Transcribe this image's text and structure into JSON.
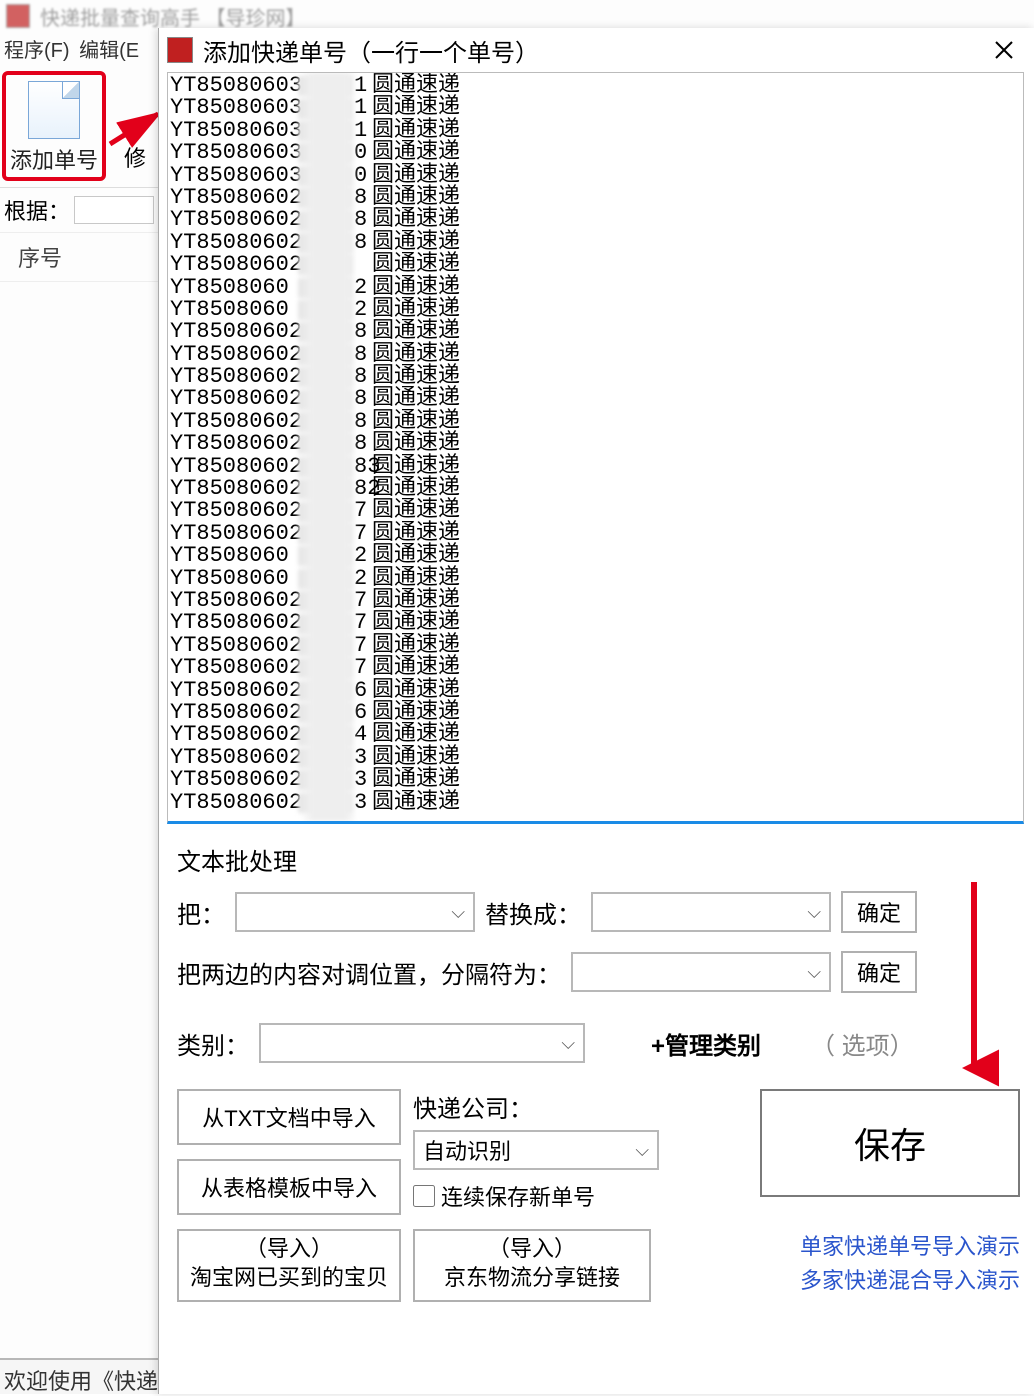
{
  "main": {
    "title": "快递批量查询高手 【导珍网】",
    "menu": {
      "program": "程序(F)",
      "edit": "编辑(E"
    },
    "toolbar": {
      "add_tracking": "添加单号",
      "modify": "修"
    },
    "filter_label": "根据：",
    "table": {
      "col_seq": "序号"
    },
    "status": "欢迎使用《快递"
  },
  "dialog": {
    "title": "添加快递单号（一行一个单号）",
    "tracking_rows": [
      {
        "p": "YT85080603",
        "s": "1",
        "c": "圆通速递"
      },
      {
        "p": "YT85080603",
        "s": "1",
        "c": "圆通速递"
      },
      {
        "p": "YT85080603",
        "s": "1",
        "c": "圆通速递"
      },
      {
        "p": "YT85080603",
        "s": "0",
        "c": "圆通速递"
      },
      {
        "p": "YT85080603",
        "s": "0",
        "c": "圆通速递"
      },
      {
        "p": "YT85080602",
        "s": "8",
        "c": "圆通速递"
      },
      {
        "p": "YT85080602",
        "s": "8",
        "c": "圆通速递"
      },
      {
        "p": "YT85080602",
        "s": "8",
        "c": "圆通速递"
      },
      {
        "p": "YT85080602",
        "s": "",
        "c": "圆通速递"
      },
      {
        "p": "YT8508060",
        "s": "2",
        "c": "圆通速递"
      },
      {
        "p": "YT8508060",
        "s": "2",
        "c": "圆通速递"
      },
      {
        "p": "YT85080602",
        "s": "8",
        "c": "圆通速递"
      },
      {
        "p": "YT85080602",
        "s": "8",
        "c": "圆通速递"
      },
      {
        "p": "YT85080602",
        "s": "8",
        "c": "圆通速递"
      },
      {
        "p": "YT85080602",
        "s": "8",
        "c": "圆通速递"
      },
      {
        "p": "YT85080602",
        "s": "8",
        "c": "圆通速递"
      },
      {
        "p": "YT85080602",
        "s": "8",
        "c": "圆通速递"
      },
      {
        "p": "YT85080602",
        "s": "83",
        "c": "圆通速递"
      },
      {
        "p": "YT85080602",
        "s": "82",
        "c": "圆通速递"
      },
      {
        "p": "YT85080602",
        "s": "7",
        "c": "圆通速递"
      },
      {
        "p": "YT85080602",
        "s": "7",
        "c": "圆通速递"
      },
      {
        "p": "YT8508060",
        "s": "2",
        "c": "圆通速递"
      },
      {
        "p": "YT8508060",
        "s": "2",
        "c": "圆通速递"
      },
      {
        "p": "YT85080602",
        "s": "7",
        "c": "圆通速递"
      },
      {
        "p": "YT85080602",
        "s": "7",
        "c": "圆通速递"
      },
      {
        "p": "YT85080602",
        "s": "7",
        "c": "圆通速递"
      },
      {
        "p": "YT85080602",
        "s": "7",
        "c": "圆通速递"
      },
      {
        "p": "YT85080602",
        "s": "6",
        "c": "圆通速递"
      },
      {
        "p": "YT85080602",
        "s": "6",
        "c": "圆通速递"
      },
      {
        "p": "YT85080602",
        "s": "4",
        "c": "圆通速递"
      },
      {
        "p": "YT85080602",
        "s": "3",
        "c": "圆通速递"
      },
      {
        "p": "YT85080602",
        "s": "3",
        "c": "圆通速递"
      },
      {
        "p": "YT85080602",
        "s": "3",
        "c": "圆通速递"
      }
    ],
    "batch": {
      "title": "文本批处理",
      "replace_from_label": "把：",
      "replace_to_label": "替换成：",
      "confirm": "确定",
      "swap_label": "把两边的内容对调位置，分隔符为：",
      "confirm2": "确定"
    },
    "category": {
      "label": "类别：",
      "manage": "+管理类别",
      "optional": "（    选项）"
    },
    "import_txt": "从TXT文档中导入",
    "import_tpl": "从表格模板中导入",
    "courier": {
      "label": "快递公司：",
      "value": "自动识别"
    },
    "continuous_save": "连续保存新单号",
    "save": "保存",
    "import_tb_line1": "（导入）",
    "import_tb_line2": "淘宝网已买到的宝贝",
    "import_jd_line1": "（导入）",
    "import_jd_line2": "京东物流分享链接",
    "demo1": "单家快递单号导入演示",
    "demo2": "多家快递混合导入演示"
  }
}
